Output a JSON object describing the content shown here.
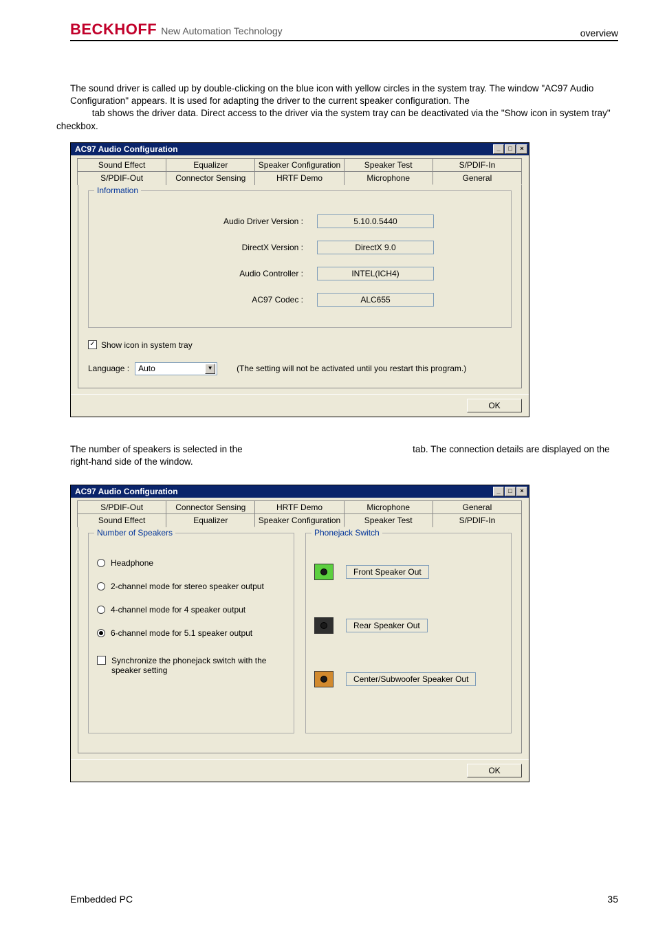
{
  "header": {
    "logo": "BECKHOFF",
    "tagline": "New Automation Technology",
    "right": "overview"
  },
  "para1": "The sound driver is called up by double-clicking on the blue icon with yellow circles in the system tray. The window \"AC97 Audio Configuration\" appears. It is used for adapting the driver to the current speaker configuration. The ",
  "para1b": "tab shows the driver data. Direct access to the driver via the system tray can be deactivated via the \"Show icon in system tray\" checkbox.",
  "para2a": "The number of speakers is selected in the ",
  "para2b": "tab. The connection details are displayed on the right-hand side of the window.",
  "dlg": {
    "title": "AC97 Audio Configuration",
    "tabsRow1": [
      "Sound Effect",
      "Equalizer",
      "Speaker Configuration",
      "Speaker Test",
      "S/PDIF-In"
    ],
    "tabsRow2": [
      "S/PDIF-Out",
      "Connector Sensing",
      "HRTF Demo",
      "Microphone",
      "General"
    ],
    "info": {
      "legend": "Information",
      "rows": [
        {
          "label": "Audio Driver Version :",
          "value": "5.10.0.5440"
        },
        {
          "label": "DirectX Version :",
          "value": "DirectX 9.0"
        },
        {
          "label": "Audio Controller :",
          "value": "INTEL(ICH4)"
        },
        {
          "label": "AC97 Codec :",
          "value": "ALC655"
        }
      ]
    },
    "showIcon": "Show icon in system tray",
    "langLabel": "Language :",
    "langValue": "Auto",
    "langNote": "(The setting will not be activated until you restart this program.)",
    "ok": "OK"
  },
  "dlg2": {
    "tabsRow1": [
      "S/PDIF-Out",
      "Connector Sensing",
      "HRTF Demo",
      "Microphone",
      "General"
    ],
    "tabsRow2": [
      "Sound Effect",
      "Equalizer",
      "Speaker Configuration",
      "Speaker Test",
      "S/PDIF-In"
    ],
    "numLegend": "Number of Speakers",
    "jackLegend": "Phonejack Switch",
    "radios": [
      "Headphone",
      "2-channel mode for stereo speaker output",
      "4-channel mode for 4 speaker output",
      "6-channel mode for 5.1 speaker output"
    ],
    "syncChk": "Synchronize the phonejack switch with the speaker setting",
    "jacks": [
      {
        "cls": "green",
        "label": "Front Speaker Out"
      },
      {
        "cls": "black",
        "label": "Rear Speaker Out"
      },
      {
        "cls": "orange",
        "label": "Center/Subwoofer Speaker Out"
      }
    ]
  },
  "footer": {
    "left": "Embedded PC",
    "right": "35"
  }
}
